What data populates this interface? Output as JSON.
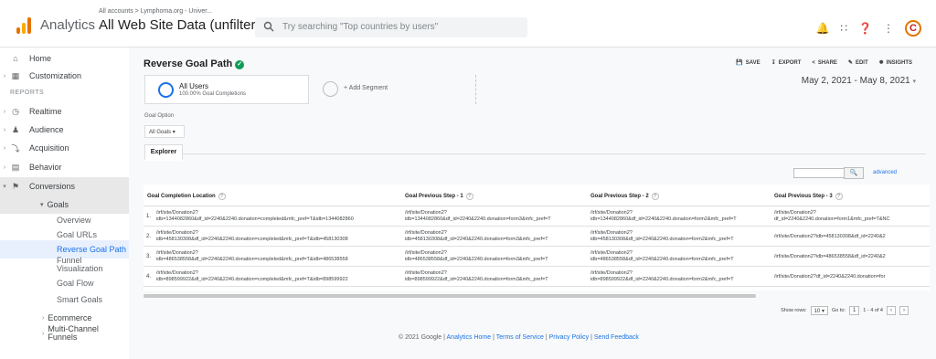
{
  "header": {
    "app_name": "Analytics",
    "account_breadcrumb": "All accounts > Lymphoma.org - Univer...",
    "view_name": "All Web Site Data (unfiltered)",
    "search_placeholder": "Try searching \"Top countries by users\"",
    "avatar_letter": "C"
  },
  "sidebar": {
    "home": "Home",
    "customization": "Customization",
    "reports_label": "REPORTS",
    "realtime": "Realtime",
    "audience": "Audience",
    "acquisition": "Acquisition",
    "behavior": "Behavior",
    "conversions": "Conversions",
    "goals": "Goals",
    "overview": "Overview",
    "goal_urls": "Goal URLs",
    "reverse_goal_path": "Reverse Goal Path",
    "funnel_visualization_1": "Funnel",
    "funnel_visualization_2": "Visualization",
    "goal_flow": "Goal Flow",
    "smart_goals": "Smart Goals",
    "ecommerce": "Ecommerce",
    "multi_channel_1": "Multi-Channel",
    "multi_channel_2": "Funnels"
  },
  "report": {
    "title": "Reverse Goal Path",
    "actions": {
      "save": "SAVE",
      "export": "EXPORT",
      "share": "SHARE",
      "edit": "EDIT",
      "insights": "INSIGHTS"
    },
    "segment": {
      "name": "All Users",
      "sub": "100.00% Goal Completions",
      "add": "+ Add Segment"
    },
    "date_range": "May 2, 2021 - May 8, 2021",
    "goal_option_label": "Goal Option",
    "goal_option_value": "All Goals",
    "tab_explorer": "Explorer",
    "advanced": "advanced"
  },
  "table": {
    "headers": [
      "Goal Completion Location",
      "Goal Previous Step - 1",
      "Goal Previous Step - 2",
      "Goal Previous Step - 3"
    ],
    "rows": [
      {
        "n": "1.",
        "c1a": "/irf/site/Donation2?",
        "c1b": "idb=1344082860&df_id=2240&2240.donation=completed&mfc_pref=T&idb=1344082860",
        "c2a": "/irf/site/Donation2?",
        "c2b": "idb=1344082860&df_id=2240&2240.donation=form3&mfc_pref=T",
        "c3a": "/irf/site/Donation2?",
        "c3b": "idb=1344082860&df_id=2240&2240.donation=form2&mfc_pref=T",
        "c4a": "/irf/site/Donation2?",
        "c4b": "df_id=2240&2240.donation=form1&mfc_pref=T&NC"
      },
      {
        "n": "2.",
        "c1a": "/irf/site/Donation2?",
        "c1b": "idb=458130308&df_id=2240&2240.donation=completed&mfc_pref=T&idb=458130308",
        "c2a": "/irf/site/Donation2?",
        "c2b": "idb=458130308&df_id=2240&2240.donation=form3&mfc_pref=T",
        "c3a": "/irf/site/Donation2?",
        "c3b": "idb=458130308&df_id=2240&2240.donation=form2&mfc_pref=T",
        "c4a": "/irf/site/Donation2?idb=458130308&df_id=2240&2",
        "c4b": ""
      },
      {
        "n": "3.",
        "c1a": "/irf/site/Donation2?",
        "c1b": "idb=486538558&df_id=2240&2240.donation=completed&mfc_pref=T&idb=486538558",
        "c2a": "/irf/site/Donation2?",
        "c2b": "idb=486538558&df_id=2240&2240.donation=form3&mfc_pref=T",
        "c3a": "/irf/site/Donation2?",
        "c3b": "idb=486538558&df_id=2240&2240.donation=form2&mfc_pref=T",
        "c4a": "/irf/site/Donation2?idb=486538558&df_id=2240&2",
        "c4b": ""
      },
      {
        "n": "4.",
        "c1a": "/irf/site/Donation2?",
        "c1b": "idb=898599922&df_id=2240&2240.donation=completed&mfc_pref=T&idb=898599922",
        "c2a": "/irf/site/Donation2?",
        "c2b": "idb=898599922&df_id=2240&2240.donation=form3&mfc_pref=T",
        "c3a": "/irf/site/Donation2?",
        "c3b": "idb=898599922&df_id=2240&2240.donation=form2&mfc_pref=T",
        "c4a": "/irf/site/Donation2?df_id=2240&2240.donation=for",
        "c4b": ""
      }
    ],
    "show_rows_label": "Show rows:",
    "show_rows_value": "10",
    "goto_label": "Go to:",
    "goto_value": "1",
    "range": "1 - 4 of 4"
  },
  "footer": {
    "copyright": "© 2021 Google | ",
    "analytics_home": "Analytics Home",
    "sep1": " | ",
    "terms": "Terms of Service",
    "sep2": " | ",
    "privacy": "Privacy Policy",
    "sep3": " | ",
    "feedback": "Send Feedback"
  }
}
